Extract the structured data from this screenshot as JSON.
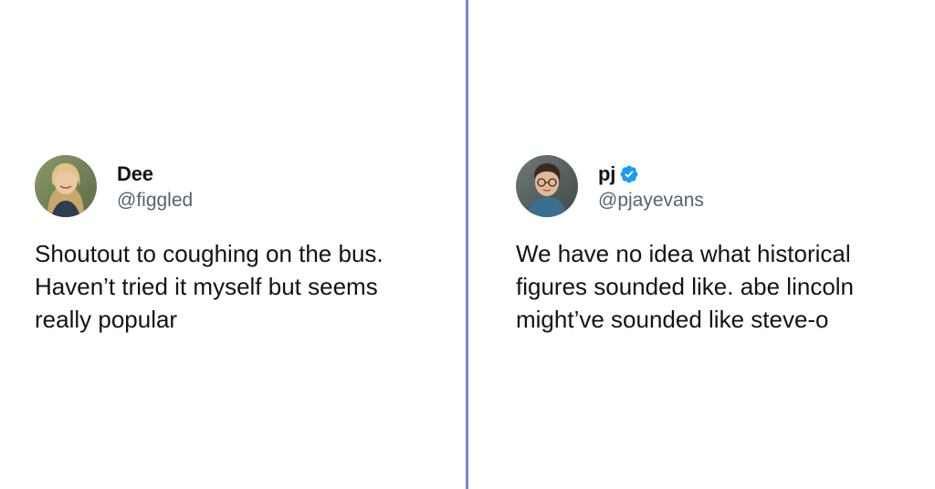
{
  "tweets": [
    {
      "display_name": "Dee",
      "handle": "@figgled",
      "verified": false,
      "lines": [
        "Shoutout to coughing on the bus.",
        "Haven’t tried it myself but seems",
        "really popular"
      ]
    },
    {
      "display_name": "pj",
      "handle": "@pjayevans",
      "verified": true,
      "lines": [
        "We have no idea what historical",
        "figures sounded like. abe lincoln",
        "might’ve sounded like steve-o"
      ]
    }
  ],
  "colors": {
    "divider": "#7b7fe8",
    "verified_badge": "#1d9bf0",
    "handle": "#536471",
    "text": "#0f1419"
  },
  "icons": {
    "verified": "verified-badge-icon"
  }
}
